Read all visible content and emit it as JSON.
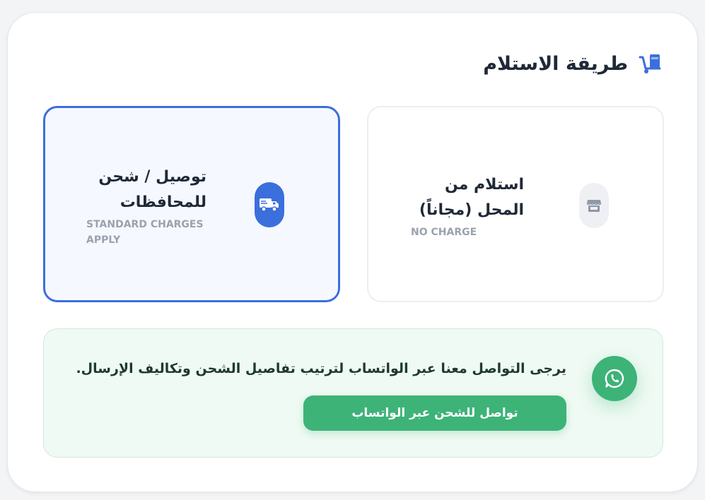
{
  "section": {
    "title": "طريقة الاستلام",
    "icon": "dolly-icon"
  },
  "options": [
    {
      "id": "pickup",
      "title": "استلام من المحل (مجاناً)",
      "subtitle": "NO CHARGE",
      "icon": "store-icon",
      "selected": false
    },
    {
      "id": "delivery",
      "title": "توصيل / شحن للمحافظات",
      "subtitle": "STANDARD CHARGES APPLY",
      "icon": "truck-icon",
      "selected": true
    }
  ],
  "whatsapp": {
    "message": "يرجى التواصل معنا عبر الواتساب لترتيب تفاصيل الشحن وتكاليف الإرسال.",
    "button_label": "تواصل للشحن عبر الواتساب",
    "icon": "whatsapp-icon"
  },
  "colors": {
    "accent": "#3b6fdb",
    "whatsapp_green": "#3db378",
    "whatsapp_bg": "#eefaf3"
  }
}
